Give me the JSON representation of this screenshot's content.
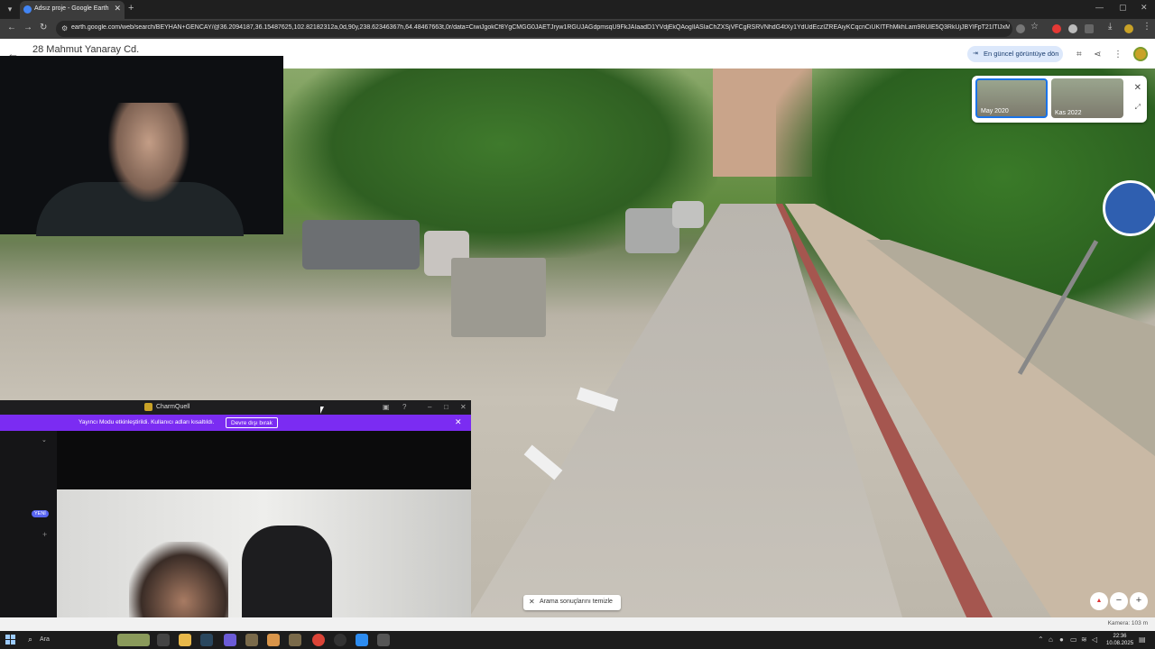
{
  "browser": {
    "tab_title": "Adsız proje - Google Earth",
    "url": "earth.google.com/web/search/BEYHAN+GENCAY/@36.2094187,36.15487625,102.82182312a,0d,90y,238.62346367h,64.48467663t,0r/data=CiwiJgokCf8YgCMGG0JAETJryw1RGUJAGdpmsqU9FkJAIaadD1YVdjEkQAogIlASIaChZXSjVFCgRSRVNhdG4tXy1YdUdEczIZREAiyKCqcnCiUKITFhMkhLam9RUlE5Q3RkUjJBYlFpT21lTlJxMMG9Ym1jMyABOgM..."
  },
  "earth": {
    "location_title": "28 Mahmut Yanaray Cd.",
    "latest_view_label": "En güncel görüntüye dön",
    "timeline": [
      {
        "label": "May 2020",
        "selected": true
      },
      {
        "label": "Kas 2022",
        "selected": false
      }
    ],
    "clear_search_label": "Arama sonuçlarını temizle",
    "camera_label": "Kamera: 103 m"
  },
  "charm": {
    "app_name": "CharmQuell",
    "streamer_msg": "Yayıncı Modu etkinleştirildi. Kullanıcı adları kısaltıldı.",
    "disable_label": "Devre dışı bırak",
    "new_badge": "YENİ"
  },
  "taskbar": {
    "search_label": "Ara",
    "time": "22:36",
    "date": "10.08.2025"
  },
  "colors": {
    "accent_purple": "#7b2cf2",
    "earth_blue": "#1a73e8"
  }
}
